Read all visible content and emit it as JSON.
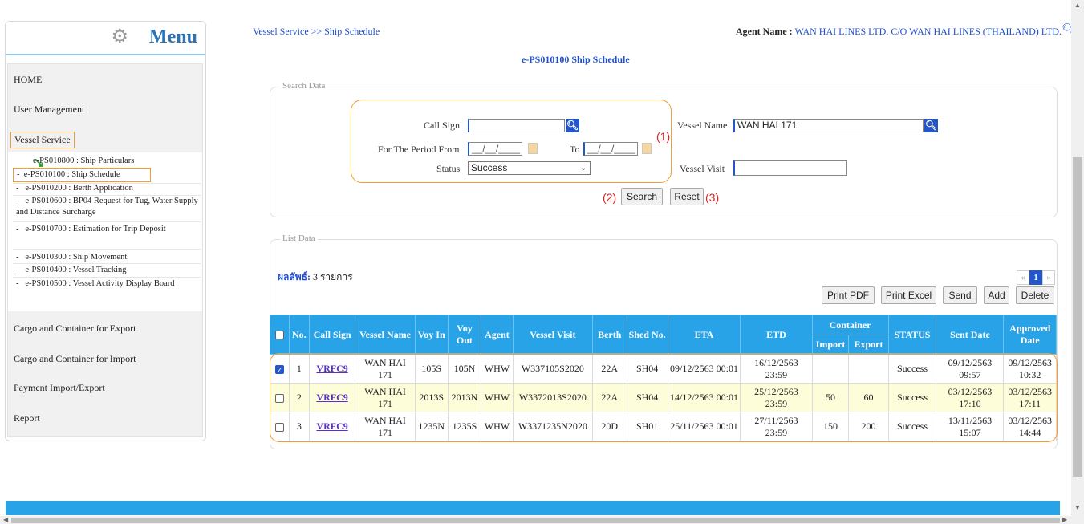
{
  "menu": {
    "title": "Menu",
    "items": [
      "HOME",
      "User Management",
      "Vessel Service",
      "Cargo and Container for Export",
      "Cargo and Container for Import",
      "Payment Import/Export",
      "Report"
    ],
    "submenu": [
      "e-PS010800 : Ship Particulars",
      "e-PS010100 : Ship Schedule",
      "e-PS010200 : Berth Application",
      "e-PS010600 : BP04 Request for Tug, Water Supply and Distance Surcharge",
      "e-PS010700 : Estimation for Trip Deposit",
      "e-PS010300 : Ship Movement",
      "e-PS010400 : Vessel Tracking",
      "e-PS010500 : Vessel Activity Display Board"
    ]
  },
  "header": {
    "breadcrumb": "Vessel Service >> Ship Schedule",
    "agent_label": "Agent Name :",
    "agent_value": "WAN HAI LINES LTD. C/O WAN HAI LINES (THAILAND) LTD.",
    "page_title": "e-PS010100 Ship Schedule"
  },
  "search": {
    "legend": "Search Data",
    "call_sign_label": "Call Sign",
    "call_sign_value": "",
    "vessel_name_label": "Vessel Name",
    "vessel_name_value": "WAN HAI 171",
    "period_from_label": "For The Period From",
    "period_from_value": "__/__/____",
    "to_label": "To",
    "to_value": "__/__/____",
    "status_label": "Status",
    "status_value": "Success",
    "vessel_visit_label": "Vessel Visit",
    "vessel_visit_value": "",
    "annotation_1": "(1)",
    "annotation_2": "(2)",
    "annotation_3": "(3)",
    "search_button": "Search",
    "reset_button": "Reset"
  },
  "list": {
    "legend": "List Data",
    "result_label": "ผลลัพธ์:",
    "result_count": "3 รายการ",
    "pager": {
      "prev": "«",
      "page": "1",
      "next": "»"
    },
    "buttons": {
      "print_pdf": "Print PDF",
      "print_excel": "Print Excel",
      "send": "Send",
      "add": "Add",
      "delete": "Delete"
    },
    "headers": {
      "no": "No.",
      "call_sign": "Call Sign",
      "vessel_name": "Vessel Name",
      "voy_in": "Voy In",
      "voy_out": "Voy Out",
      "agent": "Agent",
      "vessel_visit": "Vessel Visit",
      "berth": "Berth",
      "shed_no": "Shed No.",
      "eta": "ETA",
      "etd": "ETD",
      "container": "Container",
      "import": "Import",
      "export": "Export",
      "status": "STATUS",
      "sent_date": "Sent Date",
      "approved_date": "Approved Date"
    },
    "rows": [
      {
        "checked": true,
        "no": "1",
        "call_sign": "VRFC9",
        "vessel_name": "WAN HAI 171",
        "voy_in": "105S",
        "voy_out": "105N",
        "agent": "WHW",
        "vessel_visit": "W337105S2020",
        "berth": "22A",
        "shed": "SH04",
        "eta": "09/12/2563 00:01",
        "etd": "16/12/2563 23:59",
        "import": "",
        "export": "",
        "status": "Success",
        "sent": "09/12/2563 09:57",
        "approved": "09/12/2563 10:32"
      },
      {
        "checked": false,
        "no": "2",
        "call_sign": "VRFC9",
        "vessel_name": "WAN HAI 171",
        "voy_in": "2013S",
        "voy_out": "2013N",
        "agent": "WHW",
        "vessel_visit": "W3372013S2020",
        "berth": "22A",
        "shed": "SH04",
        "eta": "14/12/2563 00:01",
        "etd": "25/12/2563 23:59",
        "import": "50",
        "export": "60",
        "status": "Success",
        "sent": "03/12/2563 17:10",
        "approved": "03/12/2563 17:11"
      },
      {
        "checked": false,
        "no": "3",
        "call_sign": "VRFC9",
        "vessel_name": "WAN HAI 171",
        "voy_in": "1235N",
        "voy_out": "1235S",
        "agent": "WHW",
        "vessel_visit": "W3371235N2020",
        "berth": "20D",
        "shed": "SH01",
        "eta": "25/11/2563 00:01",
        "etd": "27/11/2563 23:59",
        "import": "150",
        "export": "200",
        "status": "Success",
        "sent": "13/11/2563 15:07",
        "approved": "03/12/2563 14:44"
      }
    ]
  },
  "colors": {
    "accent": "#29a3e8",
    "highlight": "#f0a030",
    "link": "#1f4fd1"
  }
}
